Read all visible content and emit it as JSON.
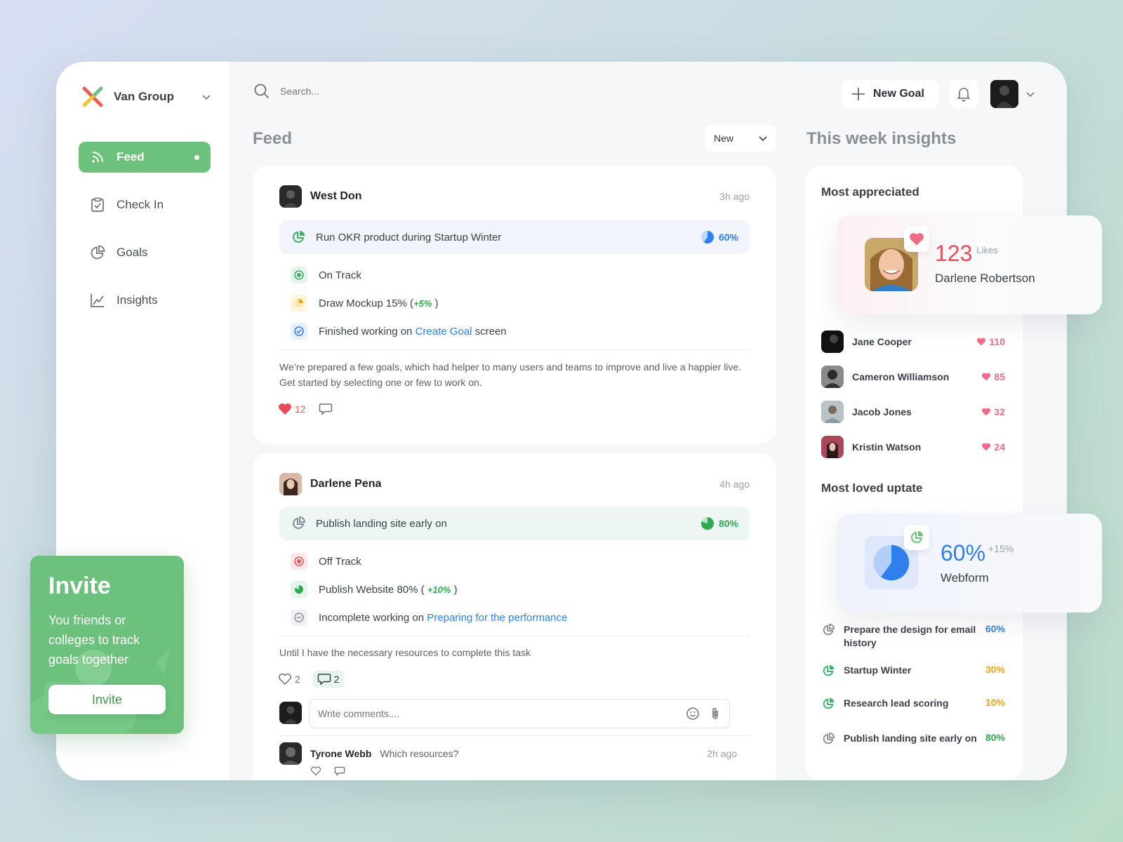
{
  "brand": {
    "name": "Van Group"
  },
  "nav": {
    "items": [
      {
        "label": "Feed",
        "icon": "rss-icon"
      },
      {
        "label": "Check In",
        "icon": "clipboard-check-icon"
      },
      {
        "label": "Goals",
        "icon": "pie-chart-icon"
      },
      {
        "label": "Insights",
        "icon": "line-chart-icon"
      }
    ]
  },
  "search": {
    "placeholder": "Search..."
  },
  "topbar": {
    "new_goal_label": "New Goal"
  },
  "feed": {
    "title": "Feed",
    "sort_value": "New",
    "posts": [
      {
        "author": "West Don",
        "time": "3h ago",
        "goal": "Run OKR product during Startup Winter",
        "goal_progress": 60,
        "goal_progress_label": "60%",
        "updates": [
          {
            "text": "On Track"
          },
          {
            "text": "Draw Mockup 15%",
            "delta": "+5%"
          },
          {
            "prefix": "Finished working on",
            "link": "Create Goal",
            "suffix": "screen"
          }
        ],
        "body": "We’re prepared a few goals, which had helper to many users and teams to improve and live a happier live. Get started by selecting one or few to work on.",
        "likes": "12"
      },
      {
        "author": "Darlene Pena",
        "time": "4h ago",
        "goal": "Publish landing site early on",
        "goal_progress": 80,
        "goal_progress_label": "80%",
        "updates": [
          {
            "text": "Off Track"
          },
          {
            "text": "Publish Website 80% (",
            "delta": "+10%"
          },
          {
            "prefix": "Incomplete working on",
            "link": "Preparing for the performance"
          }
        ],
        "body": "Until I have the necessary resources to complete this task",
        "likes": "2",
        "comments": "2",
        "comment_placeholder": "Write comments....",
        "reply": {
          "author": "Tyrone Webb",
          "text": "Which resources?",
          "time": "2h ago"
        }
      }
    ]
  },
  "insights": {
    "title": "This week insights",
    "most_appreciated": {
      "title": "Most appreciated",
      "top": {
        "name": "Darlene Robertson",
        "count": "123",
        "unit": "Likes"
      },
      "list": [
        {
          "name": "Jane Cooper",
          "likes": "110"
        },
        {
          "name": "Cameron Williamson",
          "likes": "85"
        },
        {
          "name": "Jacob Jones",
          "likes": "32"
        },
        {
          "name": "Kristin Watson",
          "likes": "24"
        }
      ]
    },
    "most_loved": {
      "title": "Most loved uptate",
      "top": {
        "name": "Webform",
        "percent": "60%",
        "delta": "+15%",
        "progress": 60
      },
      "list": [
        {
          "name": "Prepare the design for email history",
          "percent": "60%",
          "color": "#2f80ed"
        },
        {
          "name": "Startup Winter",
          "percent": "30%",
          "color": "#f2a516"
        },
        {
          "name": "Research lead scoring",
          "percent": "10%",
          "color": "#f2a516"
        },
        {
          "name": "Publish landing site early on",
          "percent": "80%",
          "color": "#2fa84f"
        }
      ]
    }
  },
  "invite": {
    "title": "Invite",
    "text": "You friends or colleges to track goals together",
    "button": "Invite"
  },
  "colors": {
    "accent": "#6cc27c",
    "link": "#2f80ed",
    "like": "#f06a86",
    "danger": "#eb5757"
  }
}
